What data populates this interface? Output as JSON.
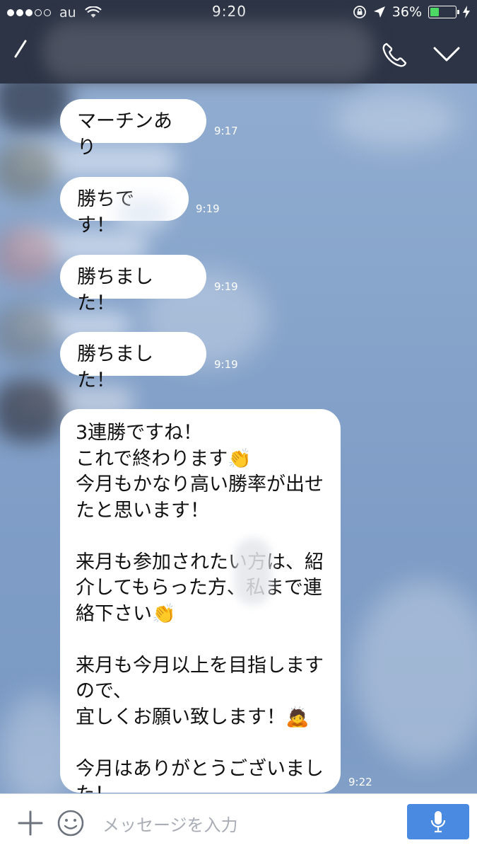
{
  "status_bar": {
    "carrier": "au",
    "time": "9:20",
    "battery": "36%",
    "battery_level": 0.36
  },
  "header": {
    "icons": [
      "back-icon",
      "phone-icon",
      "chevron-down-icon"
    ]
  },
  "messages": [
    {
      "text": "マーチンあり",
      "time": "9:17"
    },
    {
      "text": "勝ちです！",
      "time": "9:19"
    },
    {
      "text": "勝ちました！",
      "time": "9:19"
    },
    {
      "text": "勝ちました！",
      "time": "9:19"
    },
    {
      "text": "3連勝ですね！\nこれで終わります👏\n今月もかなり高い勝率が出せたと思います！\n\n来月も参加されたい方は、紹介してもらった方、私まで連絡下さい👏\n\n来月も今月以上を目指しますので、\n宜しくお願い致します！🙇\n\n今月はありがとうございました！",
      "time": "9:22"
    }
  ],
  "input_bar": {
    "placeholder": "メッセージを入力"
  }
}
